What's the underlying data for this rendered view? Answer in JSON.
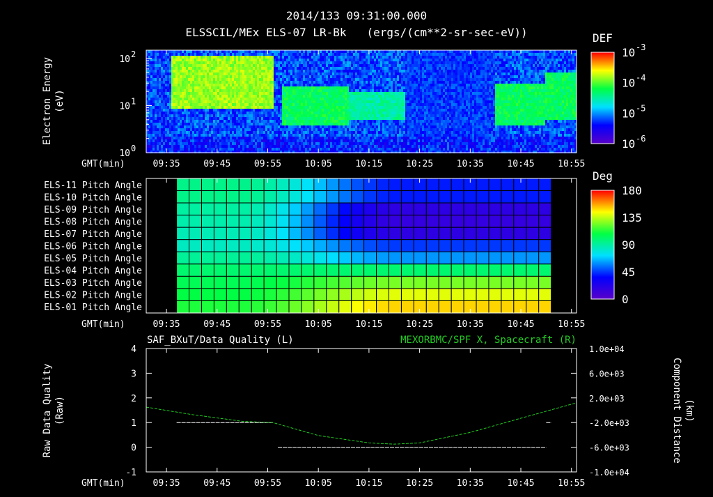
{
  "header": {
    "datetime": "2014/133 09:31:00.000",
    "subtitle": "ELSSCIL/MEx ELS-07 LR-Bk   (ergs/(cm**2-sr-sec-eV))"
  },
  "colors": {
    "background": "#000000",
    "text": "#ffffff",
    "right_series": "#22cc22",
    "grid": "#000000"
  },
  "time_axis": {
    "label": "GMT(min)",
    "ticks": [
      "09:35",
      "09:45",
      "09:55",
      "10:05",
      "10:15",
      "10:25",
      "10:35",
      "10:45",
      "10:55"
    ]
  },
  "chart_data": [
    {
      "type": "heatmap",
      "ylabel_line1": "Electron Energy",
      "ylabel_line2": "(eV)",
      "y_scale": "log",
      "ylim": [
        1,
        150
      ],
      "y_ticks": [
        {
          "base": "10",
          "exp": "0",
          "value": 1
        },
        {
          "base": "10",
          "exp": "1",
          "value": 10
        },
        {
          "base": "10",
          "exp": "2",
          "value": 100
        }
      ],
      "x_range": [
        "09:31",
        "10:56"
      ],
      "colorbar": {
        "title": "DEF",
        "scale": "log",
        "ticks": [
          {
            "base": "10",
            "exp": "-3",
            "value": 0.001
          },
          {
            "base": "10",
            "exp": "-4",
            "value": 0.0001
          },
          {
            "base": "10",
            "exp": "-5",
            "value": 1e-05
          },
          {
            "base": "10",
            "exp": "-6",
            "value": 1e-06
          }
        ]
      },
      "bands": [
        {
          "from": "09:36",
          "to": "09:56",
          "energy_range": [
            8,
            120
          ],
          "level": "high"
        },
        {
          "from": "09:58",
          "to": "10:11",
          "energy_range": [
            4,
            25
          ],
          "level": "medium"
        },
        {
          "from": "10:11",
          "to": "10:22",
          "energy_range": [
            5,
            20
          ],
          "level": "low"
        },
        {
          "from": "10:22",
          "to": "10:40",
          "energy_range": [
            1,
            150
          ],
          "level": "background"
        },
        {
          "from": "10:40",
          "to": "10:50",
          "energy_range": [
            4,
            30
          ],
          "level": "medium"
        },
        {
          "from": "10:50",
          "to": "10:56",
          "energy_range": [
            5,
            50
          ],
          "level": "medium"
        }
      ]
    },
    {
      "type": "heatmap",
      "row_labels": [
        "ELS-11 Pitch Angle",
        "ELS-10 Pitch Angle",
        "ELS-09 Pitch Angle",
        "ELS-08 Pitch Angle",
        "ELS-07 Pitch Angle",
        "ELS-06 Pitch Angle",
        "ELS-05 Pitch Angle",
        "ELS-04 Pitch Angle",
        "ELS-03 Pitch Angle",
        "ELS-02 Pitch Angle",
        "ELS-01 Pitch Angle"
      ],
      "x_range": [
        "09:31",
        "10:56"
      ],
      "data_range": [
        "09:37",
        "10:51"
      ],
      "column_count": 30,
      "colorbar": {
        "title": "Deg",
        "range": [
          0,
          180
        ],
        "ticks": [
          "180",
          "135",
          "90",
          "45",
          "0"
        ]
      },
      "start_angles": [
        95,
        95,
        90,
        88,
        86,
        84,
        92,
        100,
        105,
        108,
        112
      ],
      "end_angles": [
        40,
        40,
        18,
        15,
        18,
        45,
        60,
        100,
        125,
        140,
        150
      ]
    },
    {
      "type": "line",
      "title_left": "SAF_BXuT/Data Quality (L)",
      "title_right": "MEXORBMC/SPF X, Spacecraft (R)",
      "ylabel_left_line1": "Raw Data Quality",
      "ylabel_left_line2": "(Raw)",
      "ylabel_right_line1": "Component Distance",
      "ylabel_right_line2": "(km)",
      "ylim_left": [
        -1,
        4
      ],
      "y_ticks_left": [
        "4",
        "3",
        "2",
        "1",
        "0",
        "-1"
      ],
      "ylim_right": [
        -10000,
        10000
      ],
      "y_ticks_right": [
        "1.0e+04",
        "6.0e+03",
        "2.0e+03",
        "-2.0e+03",
        "-6.0e+03",
        "-1.0e+04"
      ],
      "series": [
        {
          "name": "SAF_BXuT/Data Quality (L)",
          "axis": "left",
          "color": "#ffffff",
          "segments": [
            {
              "x": [
                "09:37",
                "09:56"
              ],
              "y": [
                1,
                1
              ]
            },
            {
              "x": [
                "09:57",
                "10:50"
              ],
              "y": [
                0,
                0
              ]
            },
            {
              "x": [
                "10:50",
                "10:51"
              ],
              "y": [
                1,
                1
              ]
            }
          ]
        },
        {
          "name": "MEXORBMC/SPF X, Spacecraft (R)",
          "axis": "right",
          "color": "#22cc22",
          "x": [
            "09:31",
            "09:40",
            "09:50",
            "09:56",
            "10:05",
            "10:15",
            "10:20",
            "10:25",
            "10:35",
            "10:45",
            "10:56"
          ],
          "y": [
            500,
            -700,
            -1800,
            -2000,
            -4100,
            -5300,
            -5500,
            -5300,
            -3600,
            -1300,
            1200
          ]
        }
      ]
    }
  ]
}
